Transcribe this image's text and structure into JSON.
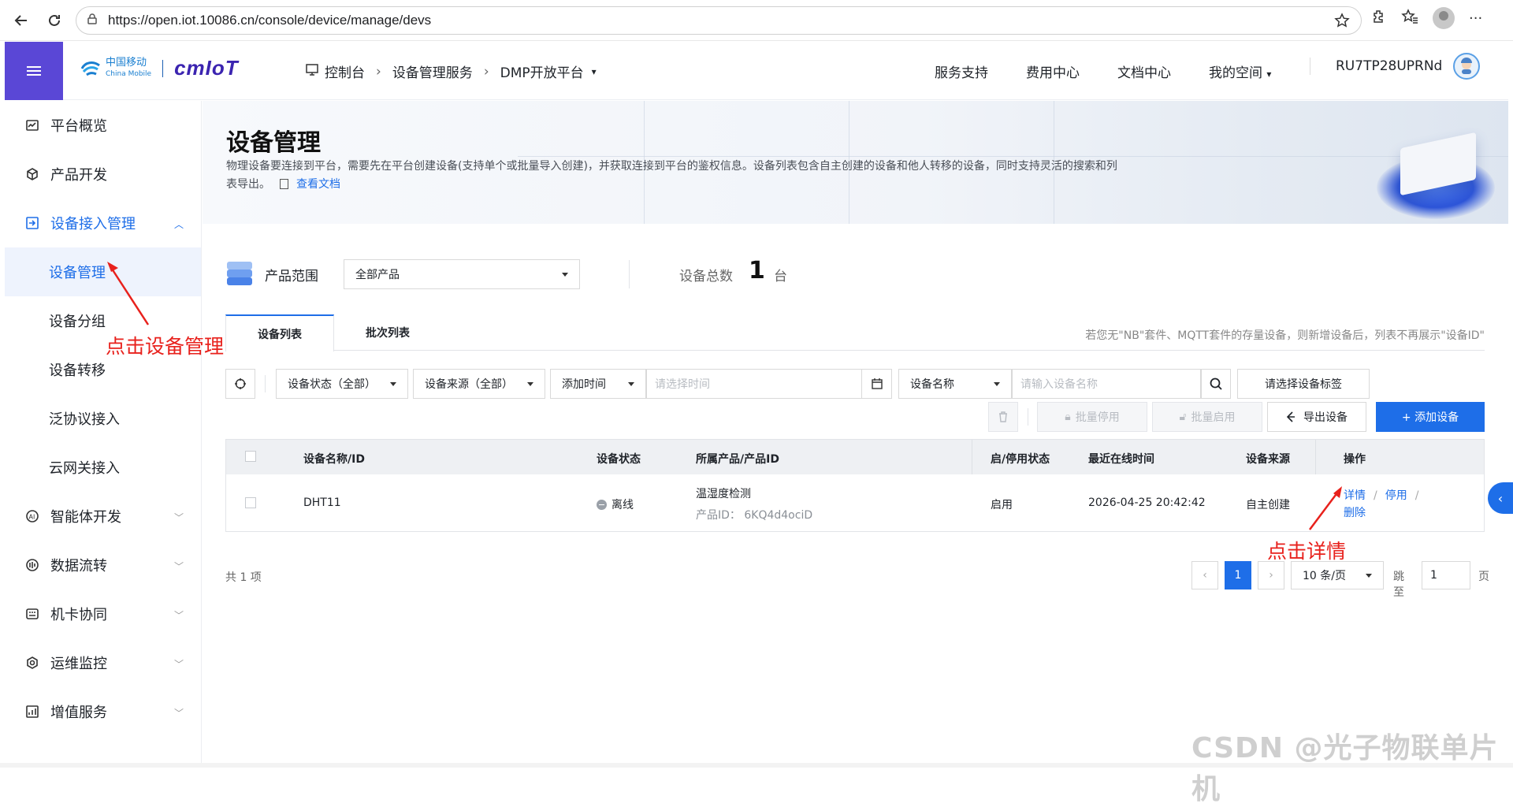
{
  "browser": {
    "url": "https://open.iot.10086.cn/console/device/manage/devs"
  },
  "header": {
    "brand_cn": "中国移动",
    "brand_en": "China Mobile",
    "brand_logo": "cmIoT",
    "breadcrumb": [
      "控制台",
      "设备管理服务",
      "DMP开放平台"
    ],
    "links": [
      "服务支持",
      "费用中心",
      "文档中心",
      "我的空间"
    ],
    "username": "RU7TP28UPRNd"
  },
  "sidebar": {
    "items": [
      {
        "label": "平台概览",
        "icon": "dashboard-icon"
      },
      {
        "label": "产品开发",
        "icon": "cube-icon"
      },
      {
        "label": "设备接入管理",
        "icon": "device-access-icon"
      }
    ],
    "sub_items": [
      "设备管理",
      "设备分组",
      "设备转移",
      "泛协议接入",
      "云网关接入"
    ],
    "items_after": [
      {
        "label": "智能体开发",
        "icon": "ai-icon"
      },
      {
        "label": "数据流转",
        "icon": "data-flow-icon"
      },
      {
        "label": "机卡协同",
        "icon": "sim-card-icon"
      },
      {
        "label": "运维监控",
        "icon": "monitor-icon"
      },
      {
        "label": "增值服务",
        "icon": "chart-icon"
      }
    ]
  },
  "banner": {
    "title": "设备管理",
    "description": "物理设备要连接到平台，需要先在平台创建设备(支持单个或批量导入创建)，并获取连接到平台的鉴权信息。设备列表包含自主创建的设备和他人转移的设备，同时支持灵活的搜索和列表导出。",
    "doc_link": "查看文档"
  },
  "filters": {
    "product_scope_label": "产品范围",
    "product_scope_value": "全部产品",
    "total_label": "设备总数",
    "total_value": "1",
    "total_unit": "台"
  },
  "tabs": {
    "items": [
      "设备列表",
      "批次列表"
    ],
    "active": "设备列表",
    "hint": "若您无\"NB\"套件、MQTT套件的存量设备，则新增设备后，列表不再展示\"设备ID\""
  },
  "toolbar": {
    "status_select": "设备状态（全部）",
    "source_select": "设备来源（全部）",
    "time_select": "添加时间",
    "time_placeholder": "请选择时间",
    "name_select": "设备名称",
    "name_placeholder": "请输入设备名称",
    "tag_button": "请选择设备标签"
  },
  "actions": {
    "batch_disable": "批量停用",
    "batch_enable": "批量启用",
    "export": "导出设备",
    "add": "+ 添加设备"
  },
  "table": {
    "columns": [
      "设备名称/ID",
      "设备状态",
      "所属产品/产品ID",
      "启/停用状态",
      "最近在线时间",
      "设备来源",
      "操作"
    ],
    "rows": [
      {
        "name": "DHT11",
        "status": "离线",
        "product": "温湿度检测",
        "product_id_label": "产品ID：",
        "product_id": "6KQ4d4ociD",
        "enabled": "启用",
        "last_online": "2026-04-25 20:42:42",
        "source": "自主创建",
        "ops": [
          "详情",
          "停用",
          "删除"
        ]
      }
    ]
  },
  "pagination": {
    "total_text": "共 1 项",
    "current_page": "1",
    "page_size": "10 条/页",
    "jump_label": "跳至",
    "jump_value": "1",
    "page_unit": "页"
  },
  "annotations": {
    "click_device_manage": "点击设备管理",
    "click_detail": "点击详情",
    "accent_color": "#e8211c"
  },
  "watermark": "CSDN @光子物联单片机",
  "colors": {
    "primary": "#1e6ee8",
    "menu_toggle": "#5a47d6"
  }
}
